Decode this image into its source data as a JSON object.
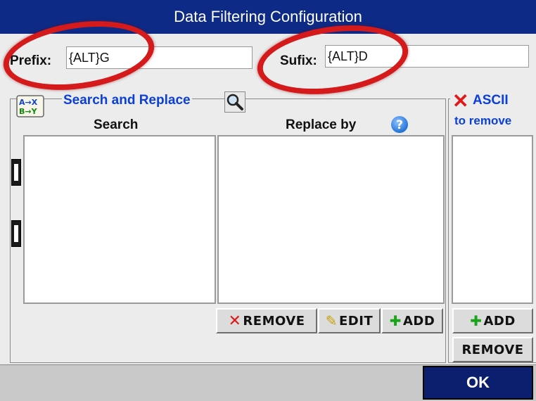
{
  "window": {
    "title": "Data Filtering Configuration"
  },
  "prefix": {
    "label": "Prefix:",
    "value": "{ALT}G"
  },
  "sufix": {
    "label": "Sufix:",
    "value": "{ALT}D"
  },
  "search_replace": {
    "group_label": "Search and Replace",
    "search_header": "Search",
    "replace_header": "Replace by",
    "remove_button": "REMOVE",
    "edit_button": "EDIT",
    "add_button": "ADD"
  },
  "ascii": {
    "title": "ASCII",
    "subtitle": "to remove",
    "add_button": "ADD",
    "remove_button": "REMOVE"
  },
  "ok_button": "OK",
  "icons": {
    "search_replace": "search-replace-icon",
    "magnifier": "magnifier-icon",
    "help": "help-icon",
    "move_up": "move-up-icon",
    "move_down": "move-down-icon",
    "ascii_remove": "red-x-icon",
    "remove": "red-x-icon",
    "edit": "pencil-icon",
    "add": "green-plus-icon"
  },
  "colors": {
    "title_bar": "#0c2a86",
    "accent_text": "#0b3fd6",
    "annotation": "#d41a1a",
    "ok_button": "#0b1f6e"
  }
}
